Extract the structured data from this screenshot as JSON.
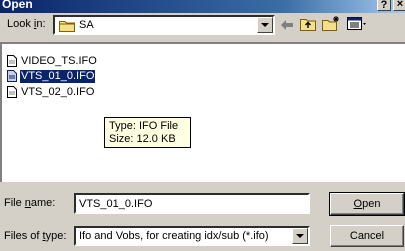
{
  "window": {
    "title": "Open",
    "help_label": "?",
    "close_label": "×"
  },
  "lookin": {
    "label_pre": "Look ",
    "label_key": "i",
    "label_post": "n:",
    "value": "SA"
  },
  "toolbar": {
    "icons": [
      "back-icon",
      "up-folder-icon",
      "new-folder-icon",
      "view-menu-icon"
    ]
  },
  "files": [
    {
      "name": "VIDEO_TS.IFO",
      "selected": false
    },
    {
      "name": "VTS_01_0.IFO",
      "selected": true
    },
    {
      "name": "VTS_02_0.IFO",
      "selected": false
    }
  ],
  "tooltip": {
    "type_line": "Type: IFO File",
    "size_line": "Size: 12.0 KB"
  },
  "filename": {
    "label_pre": "File ",
    "label_key": "n",
    "label_post": "ame:",
    "value": "VTS_01_0.IFO"
  },
  "filetype": {
    "label_pre": "Files of ",
    "label_key": "t",
    "label_post": "ype:",
    "value": "Ifo and Vobs, for creating idx/sub (*.ifo)"
  },
  "buttons": {
    "open_key": "O",
    "open_rest": "pen",
    "cancel": "Cancel"
  }
}
